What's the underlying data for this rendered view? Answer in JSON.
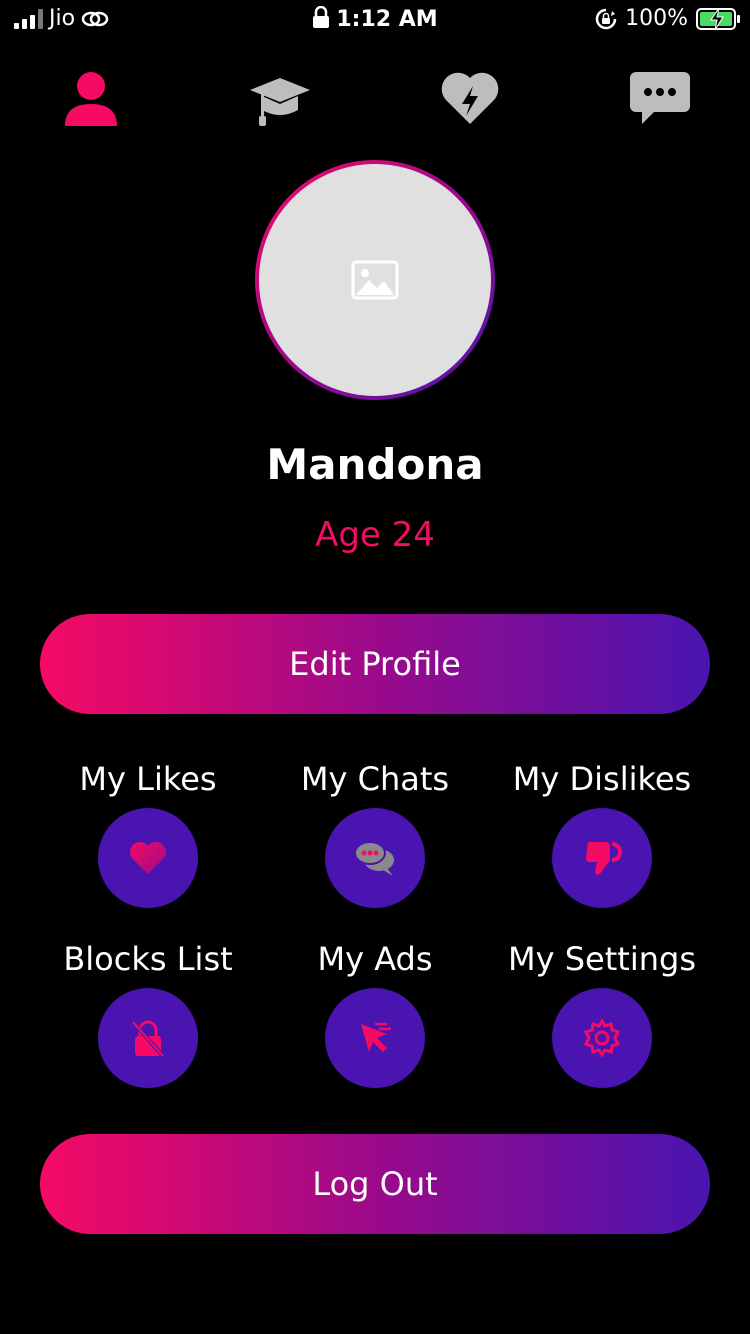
{
  "status_bar": {
    "carrier": "Jio",
    "time": "1:12 AM",
    "battery": "100%"
  },
  "top_nav": {
    "icons": [
      "profile-icon",
      "graduation-cap-icon",
      "heart-bolt-icon",
      "chat-bubble-icon"
    ],
    "active_color": "#f50a64",
    "inactive_color": "#bdbdbd"
  },
  "profile": {
    "name": "Mandona",
    "age": "Age 24"
  },
  "buttons": {
    "edit_profile": "Edit Profile",
    "log_out": "Log Out"
  },
  "options": [
    {
      "label": "My Likes",
      "icon": "heart-icon"
    },
    {
      "label": "My Chats",
      "icon": "chat-icon"
    },
    {
      "label": "My Dislikes",
      "icon": "thumbs-down-icon"
    },
    {
      "label": "Blocks List",
      "icon": "lock-slash-icon"
    },
    {
      "label": "My Ads",
      "icon": "cursor-click-icon"
    },
    {
      "label": "My Settings",
      "icon": "gear-icon"
    }
  ],
  "colors": {
    "accent_pink": "#f50a64",
    "accent_purple": "#4a14b0",
    "background": "#000000"
  }
}
